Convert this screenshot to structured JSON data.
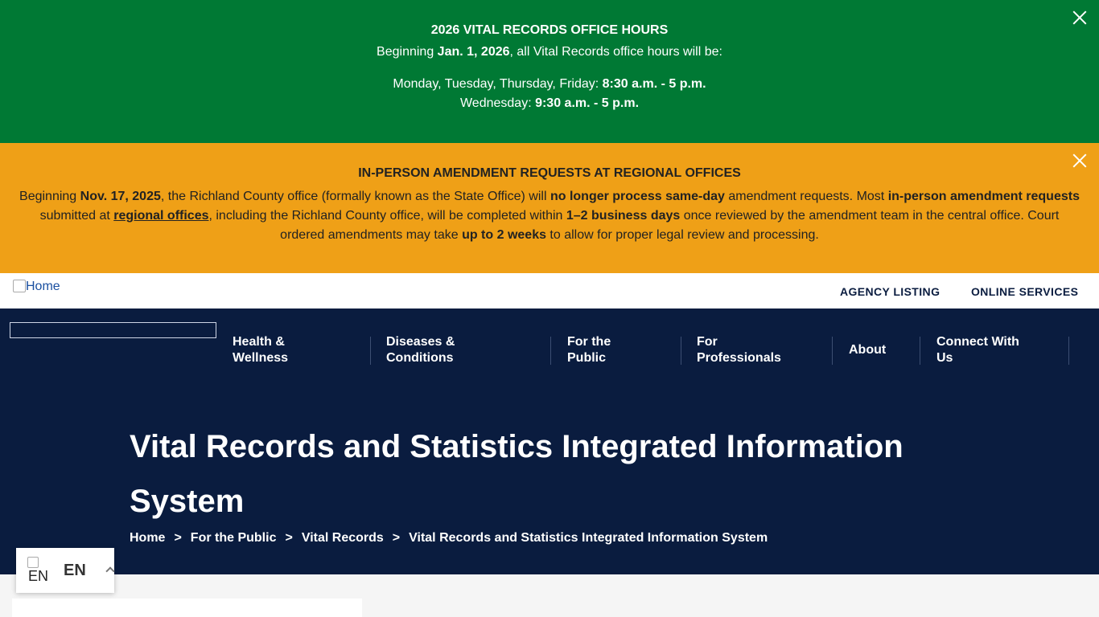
{
  "banner_green": {
    "title": "2026 VITAL RECORDS OFFICE HOURS",
    "line1_pre": "Beginning ",
    "line1_bold": "Jan. 1, 2026",
    "line1_post": ", all Vital Records office hours will be:",
    "line2_pre": "Monday, Tuesday, Thursday, Friday: ",
    "line2_bold": "8:30 a.m. - 5 p.m.",
    "line3_pre": "Wednesday: ",
    "line3_bold": "9:30 a.m. - 5 p.m."
  },
  "banner_orange": {
    "title": "IN-PERSON AMENDMENT REQUESTS AT REGIONAL OFFICES",
    "p1": "Beginning ",
    "b1": "Nov. 17, 2025",
    "p2": ", the Richland County office (formally known as the State Office) will ",
    "b2": "no longer process same-day",
    "p3": " amendment requests. Most ",
    "b3": "in-person amendment requests",
    "p4": " submitted at ",
    "link": "regional offices",
    "p5": ", including the Richland County office, will be completed within ",
    "b4": "1–2 business days",
    "p6": " once reviewed by the amendment team in the central office. Court ordered amendments may take ",
    "b5": "up to 2 weeks",
    "p7": " to allow for proper legal review and processing."
  },
  "utility": {
    "home_alt": "Home",
    "agency_listing": "AGENCY LISTING",
    "online_services": "ONLINE SERVICES"
  },
  "nav": {
    "items": [
      {
        "line1": "Health &",
        "line2": "Wellness"
      },
      {
        "line1": "Diseases &",
        "line2": "Conditions"
      },
      {
        "line1": "For the",
        "line2": "Public"
      },
      {
        "line1": "For",
        "line2": "Professionals"
      },
      {
        "line1": "About",
        "line2": ""
      },
      {
        "line1": "Connect With",
        "line2": "Us"
      }
    ]
  },
  "page": {
    "title": "Vital Records and Statistics Integrated Information System"
  },
  "breadcrumb": {
    "items": [
      "Home",
      "For the Public",
      "Vital Records",
      "Vital Records and Statistics Integrated Information System"
    ],
    "separator": ">"
  },
  "language": {
    "flag_alt": "EN",
    "code": "EN"
  },
  "colors": {
    "green_banner": "#007934",
    "orange_banner": "#efa017",
    "navy": "#0a1c3f"
  }
}
